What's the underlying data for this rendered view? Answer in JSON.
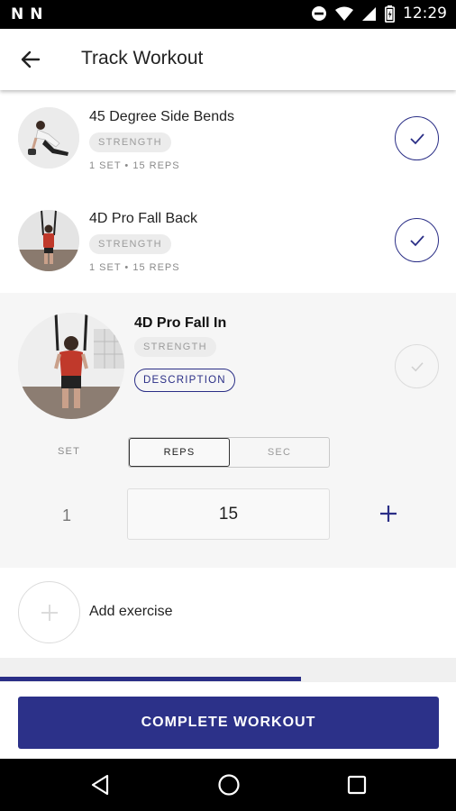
{
  "status_bar": {
    "time": "12:29",
    "left_icons": [
      "N",
      "N"
    ]
  },
  "app_bar": {
    "title": "Track Workout",
    "back_icon": "arrow-left-icon"
  },
  "exercises": [
    {
      "name": "45 Degree Side Bends",
      "tag": "STRENGTH",
      "meta": "1 SET • 15 REPS",
      "completed": true
    },
    {
      "name": "4D Pro Fall Back",
      "tag": "STRENGTH",
      "meta": "1 SET • 15 REPS",
      "completed": true
    }
  ],
  "current_exercise": {
    "name": "4D Pro Fall In",
    "tag": "STRENGTH",
    "description_label": "DESCRIPTION",
    "set_label": "SET",
    "mode_options": [
      "REPS",
      "SEC"
    ],
    "selected_mode": "REPS",
    "set_number": "1",
    "reps_value": "15",
    "completed": false
  },
  "add_exercise": {
    "label": "Add exercise"
  },
  "progress": {
    "fraction": 0.66
  },
  "complete_button": {
    "label": "COMPLETE WORKOUT"
  },
  "colors": {
    "accent": "#2a2e86",
    "button": "#2c3189",
    "tag_bg": "#ececec",
    "expanded_bg": "#f6f6f6"
  }
}
